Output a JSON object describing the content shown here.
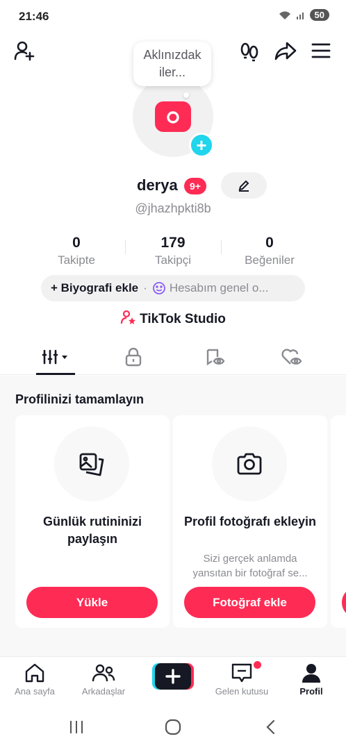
{
  "status_bar": {
    "time": "21:46",
    "battery": "50"
  },
  "top_bar": {
    "add_friend_icon": "person-plus-icon",
    "footprints_icon": "footprints-icon",
    "share_icon": "share-arrow-icon",
    "menu_icon": "hamburger-menu-icon"
  },
  "avatar": {
    "thought_bubble": "Aklınızdaki ler...",
    "thought_line1": "Aklınızdak",
    "thought_line2": "iler..."
  },
  "profile": {
    "display_name": "derya",
    "notif_badge": "9+",
    "username": "@jhazhpkti8b",
    "stats": [
      {
        "value": "0",
        "label": "Takipte"
      },
      {
        "value": "179",
        "label": "Takipçi"
      },
      {
        "value": "0",
        "label": "Beğeniler"
      }
    ],
    "bio_add": "+ Biyografi ekle",
    "bio_separator": "·",
    "bio_status": "Hesabım genel o...",
    "studio": "TikTok Studio"
  },
  "tabs": [
    "grid-icon",
    "lock-icon",
    "tagged-eye-icon",
    "liked-heart-icon"
  ],
  "complete_profile": {
    "title": "Profilinizi tamamlayın",
    "cards": [
      {
        "title": "Günlük rutininizi paylaşın",
        "description": "",
        "button": "Yükle"
      },
      {
        "title": "Profil fotoğrafı ekleyin",
        "description": "Sizi gerçek anlamda yansıtan bir fotoğraf se...",
        "button": "Fotoğraf ekle"
      }
    ]
  },
  "bottom_nav": [
    {
      "label": "Ana sayfa"
    },
    {
      "label": "Arkadaşlar"
    },
    {
      "label": "Gelen kutusu"
    },
    {
      "label": "Profil"
    }
  ],
  "colors": {
    "accent": "#fe2c55",
    "cyan": "#20d5ec",
    "text": "#161823",
    "muted": "#8a8b91"
  }
}
